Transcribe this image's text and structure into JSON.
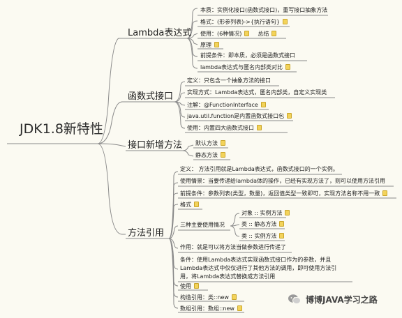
{
  "root": "JDK1.8新特性",
  "branches": {
    "lambda": {
      "title": "Lambda表达式",
      "items": [
        "本质：实例化接口(函数式接口)，重写接口抽象方法",
        "格式：(形参列表)->{执行语句}",
        "使用：(6种情况)",
        "原理",
        "前提条件：即本质，必须是函数式接口",
        "lambda表达式与匿名内部类对比"
      ],
      "usage_extra": "总结"
    },
    "functional": {
      "title": "函数式接口",
      "items": [
        "定义：只包含一个抽象方法的接口",
        "实现方式：Lambda表达式，匿名内部类，自定义实现类",
        "注解：@FunctionInterface",
        "java.util.function是内置函数式接口包",
        "使用：内置四大函数式接口"
      ]
    },
    "newmethods": {
      "title": "接口新增方法",
      "items": [
        "默认方法",
        "静态方法"
      ]
    },
    "methodref": {
      "title": "方法引用",
      "items": [
        "定义：    方法引用就是Lambda表达式，函数式接口的一个实例。",
        "使用情景：当要传递给lambda体的操作，已经有实现方法了，则可以使用方法引用",
        "前提条件：参数列表(类型，数量)，返回值类型一致即可，实现方法名称不用一致",
        "格式",
        "三种主要使用情况",
        "作用：就是可以将方法当做参数进行传递了",
        "条件：使用Lambda表达式实现函数式接口作为的参数，并且",
        "Lambda表达式中仅仅进行了其他方法的调用，即可使用方法引",
        "用，将Lambda表达式替换成方法引用",
        "使用",
        "构造引用：类::new",
        "数组引用：数组::new"
      ],
      "cases": [
        "对象 :: 实例方法",
        "类 :: 静态方法",
        "类 :: 实例方法"
      ]
    }
  },
  "watermark": "博博JAVA学习之路",
  "colors": {
    "background": "#fbfaf2",
    "line": "#8a8a8a",
    "note": "#f3d35a"
  }
}
